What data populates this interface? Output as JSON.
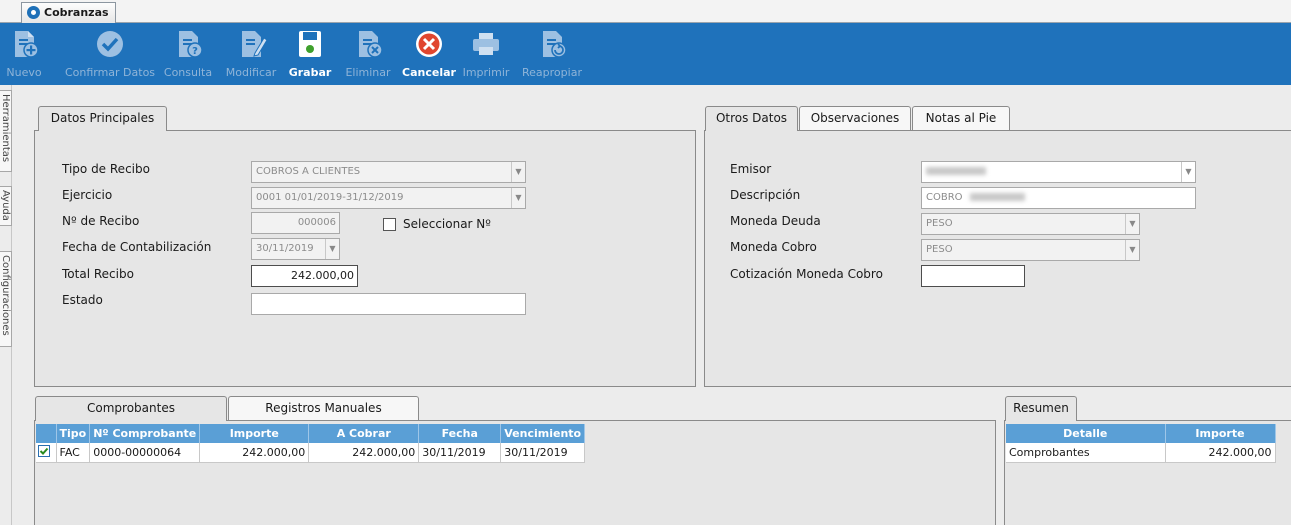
{
  "window": {
    "tab_title": "Cobranzas"
  },
  "toolbar": {
    "buttons": [
      {
        "label": "Nuevo",
        "icon": "new-doc-icon"
      },
      {
        "label": "Confirmar Datos",
        "icon": "check-icon"
      },
      {
        "label": "Consulta",
        "icon": "query-doc-icon"
      },
      {
        "label": "Modificar",
        "icon": "edit-icon"
      },
      {
        "label": "Grabar",
        "icon": "save-icon"
      },
      {
        "label": "Eliminar",
        "icon": "delete-doc-icon"
      },
      {
        "label": "Cancelar",
        "icon": "cancel-icon"
      },
      {
        "label": "Imprimir",
        "icon": "print-icon"
      },
      {
        "label": "Reapropiar",
        "icon": "reassign-doc-icon"
      }
    ]
  },
  "sidebar": {
    "tabs": [
      "Herramientas",
      "Ayuda",
      "Configuraciones"
    ]
  },
  "principal": {
    "tab": "Datos Principales",
    "labels": {
      "tipo": "Tipo de Recibo",
      "ejercicio": "Ejercicio",
      "nro": "Nº de Recibo",
      "fecha": "Fecha de Contabilización",
      "total": "Total Recibo",
      "estado": "Estado"
    },
    "values": {
      "tipo": "COBROS A CLIENTES",
      "ejercicio": "0001 01/01/2019-31/12/2019",
      "nro": "000006",
      "fecha": "30/11/2019",
      "total": "242.000,00",
      "estado": ""
    },
    "seleccionar_label": "Seleccionar Nº"
  },
  "otros": {
    "tabs": [
      "Otros Datos",
      "Observaciones",
      "Notas al Pie"
    ],
    "labels": {
      "emisor": "Emisor",
      "descripcion": "Descripción",
      "moneda_deuda": "Moneda Deuda",
      "moneda_cobro": "Moneda Cobro",
      "cotizacion": "Cotización Moneda Cobro"
    },
    "values": {
      "descripcion": "COBRO",
      "moneda_deuda": "PESO",
      "moneda_cobro": "PESO",
      "cotizacion": ""
    }
  },
  "comprobantes": {
    "tabs": [
      "Comprobantes",
      "Registros Manuales"
    ],
    "columns": [
      "Tipo",
      "Nº Comprobante",
      "Importe",
      "A Cobrar",
      "Fecha",
      "Vencimiento"
    ],
    "rows": [
      {
        "tipo": "FAC",
        "nro": "0000-00000064",
        "importe": "242.000,00",
        "a_cobrar": "242.000,00",
        "fecha": "30/11/2019",
        "vencimiento": "30/11/2019"
      }
    ]
  },
  "resumen": {
    "tab": "Resumen",
    "columns": [
      "Detalle",
      "Importe"
    ],
    "rows": [
      {
        "detalle": "Comprobantes",
        "importe": "242.000,00"
      }
    ]
  }
}
